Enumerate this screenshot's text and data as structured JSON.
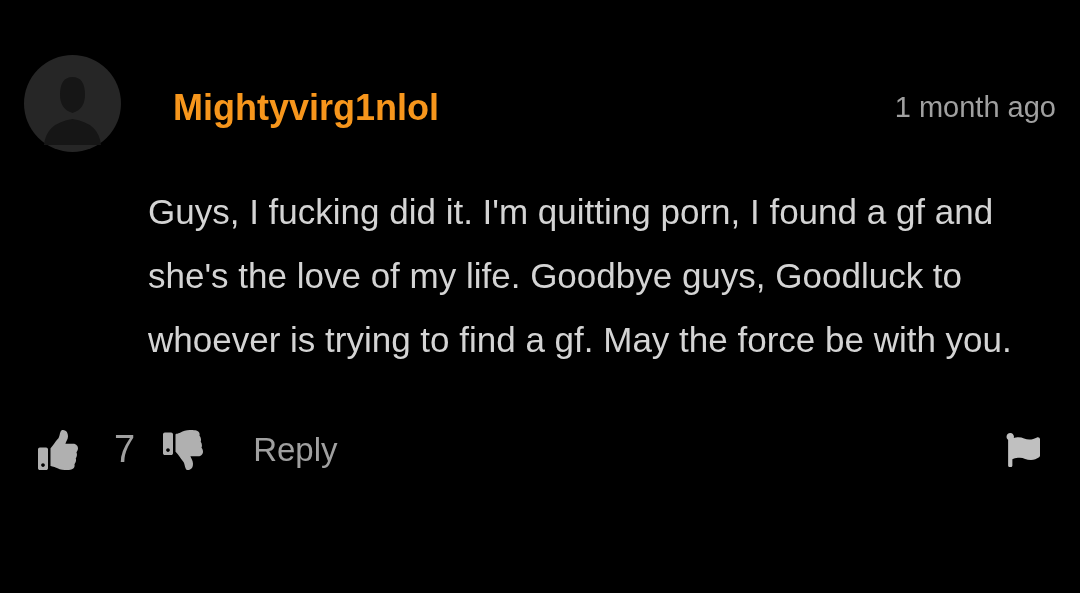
{
  "comment": {
    "author": "Mightyvirg1nlol",
    "time": "1 month ago",
    "text": "Guys, I fucking did it. I'm quitting porn, I found a gf and she's the love of my life. Goodbye guys, Goodluck to whoever is trying to find a gf. May the force be with you.",
    "likes": "7",
    "reply": "Reply"
  }
}
